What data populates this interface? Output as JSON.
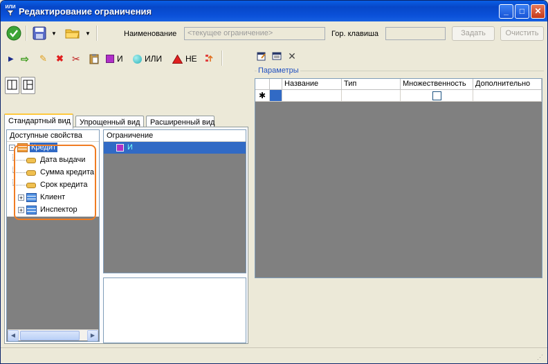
{
  "window": {
    "title": "Редактирование  ограничения",
    "icon_text": "ИЛИ"
  },
  "colors": {
    "titlebar": "#0a50d8",
    "selection": "#316ac5",
    "highlight_border": "#f07c22",
    "empty_area": "#808080",
    "and_mark": "#b030c8",
    "or_mark": "#28b0b8",
    "not_mark": "#e02020"
  },
  "toolbar": {
    "name_label": "Наименование",
    "name_placeholder": "<текущее ограничение>",
    "hotkey_label": "Гор. клавиша",
    "hotkey_value": "",
    "set_button": "Задать",
    "clear_button": "Очистить",
    "icons": [
      "ok-icon",
      "save-icon",
      "dropdown-arrow-icon",
      "folder-icon",
      "dropdown-arrow-icon"
    ]
  },
  "editor_toolbar": {
    "and_label": "И",
    "or_label": "ИЛИ",
    "not_label": "НЕ",
    "icons": [
      "play-icon",
      "arrow-right-icon",
      "pencil-icon",
      "delete-icon",
      "cut-icon",
      "paste-icon",
      "and-icon",
      "or-icon",
      "not-icon",
      "move-icon"
    ]
  },
  "tabs": [
    "Стандартный вид",
    "Упрощенный вид",
    "Расширенный вид"
  ],
  "active_tab": "Стандартный вид",
  "tree": {
    "header": "Доступные свойства",
    "items": [
      {
        "label": "Кредит",
        "expander": "-",
        "selected": true
      },
      {
        "label": "Дата выдачи"
      },
      {
        "label": "Сумма кредита"
      },
      {
        "label": "Срок кредита"
      },
      {
        "label": "Клиент",
        "expander": "+"
      },
      {
        "label": "Инспектор",
        "expander": "+"
      }
    ]
  },
  "constraint": {
    "header": "Ограничение",
    "items": [
      {
        "label": "И",
        "selected": true
      }
    ]
  },
  "params": {
    "legend": "Параметры",
    "columns": [
      "Название",
      "Тип",
      "Множественность",
      "Дополнительно"
    ],
    "new_row_marker": "✱"
  }
}
